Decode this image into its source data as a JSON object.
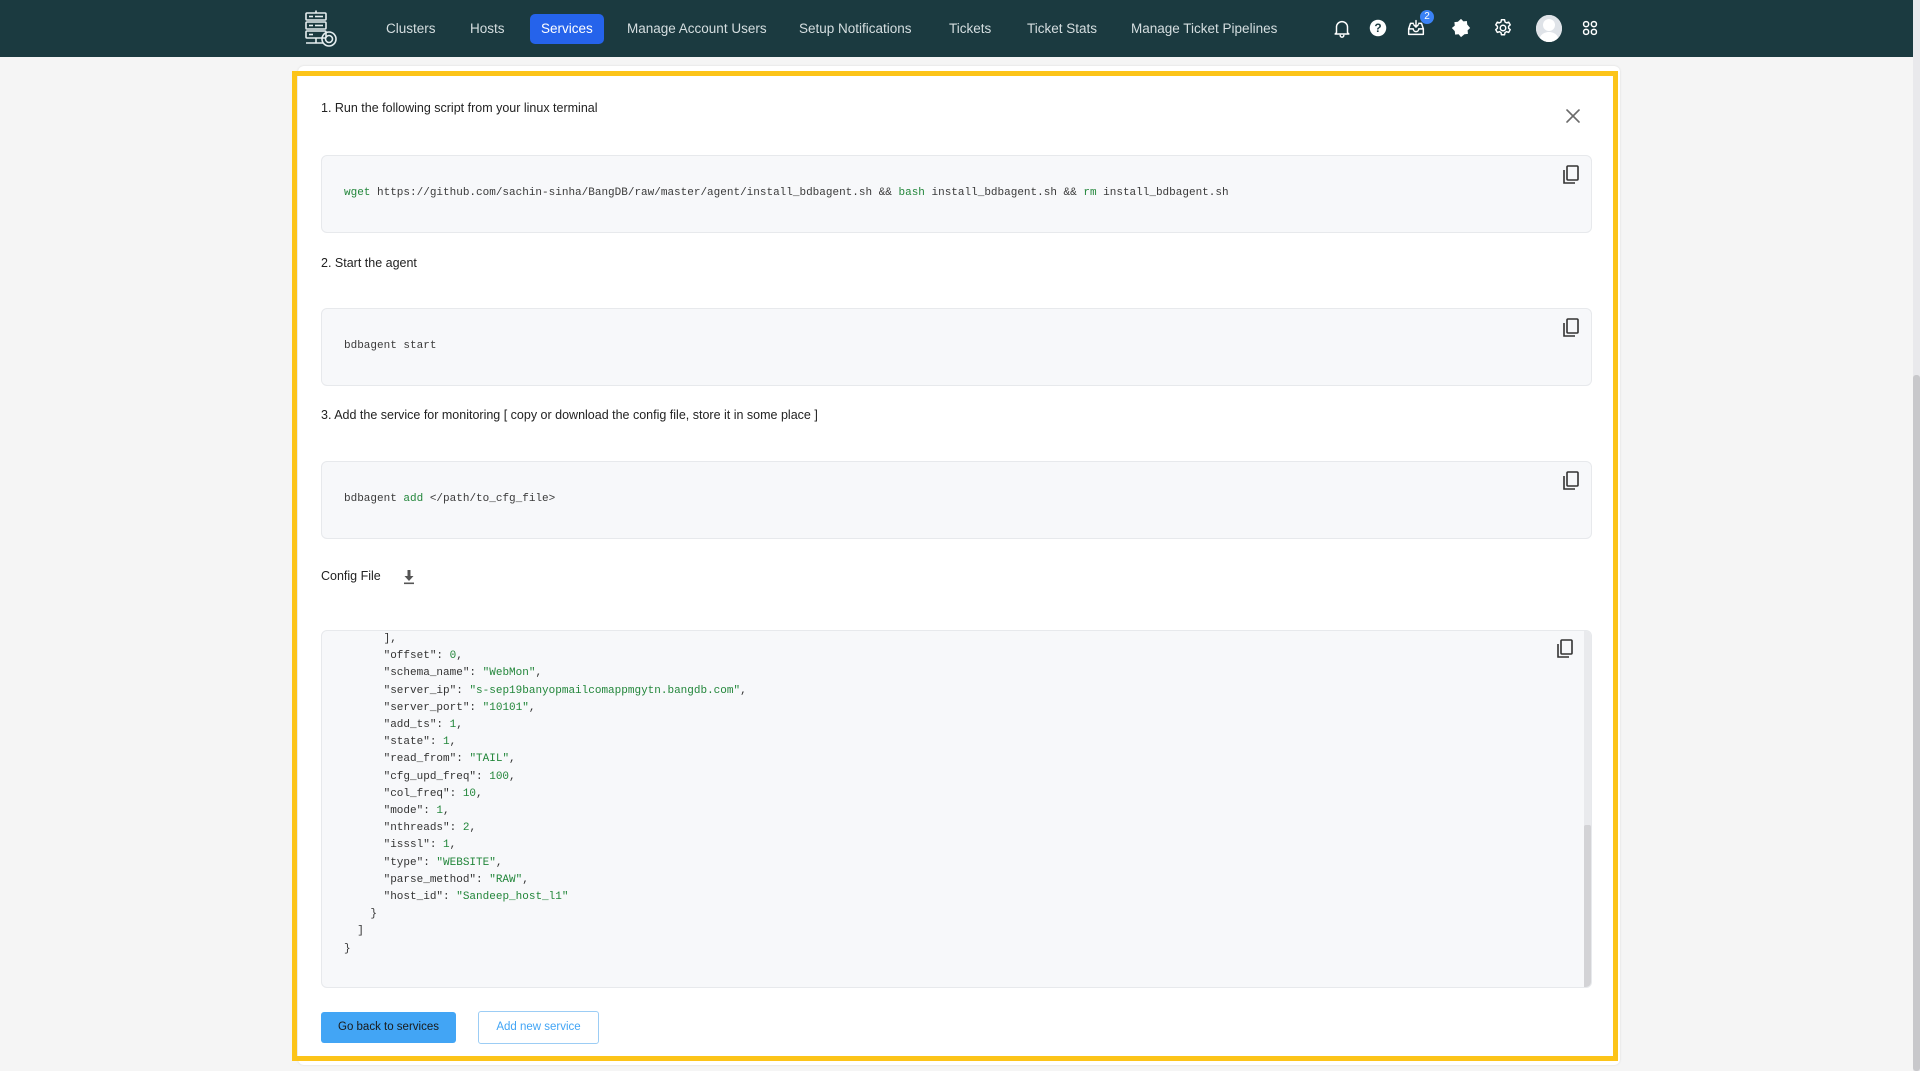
{
  "header": {
    "logo": "server-cluster-logo",
    "nav": [
      {
        "label": "Clusters",
        "active": false
      },
      {
        "label": "Hosts",
        "active": false
      },
      {
        "label": "Services",
        "active": true
      },
      {
        "label": "Manage Account Users",
        "active": false
      },
      {
        "label": "Setup Notifications",
        "active": false
      },
      {
        "label": "Tickets",
        "active": false
      },
      {
        "label": "Ticket Stats",
        "active": false
      },
      {
        "label": "Manage Ticket Pipelines",
        "active": false
      }
    ],
    "icons": [
      "bell-icon",
      "help-icon",
      "inbox-icon",
      "theme-toggle-icon",
      "settings-icon",
      "avatar",
      "apps-grid-icon"
    ],
    "inbox_badge": "2",
    "accent": "#2563eb",
    "bg": "#1b3a40"
  },
  "panel": {
    "step1": "1. Run the following script from your linux terminal",
    "step1_code": {
      "parts": [
        {
          "t": "wget",
          "kw": true
        },
        {
          "t": " https://github.com/sachin-sinha/BangDB/raw/master/agent/install_bdbagent.sh && ",
          "kw": false
        },
        {
          "t": "bash",
          "kw": true
        },
        {
          "t": " install_bdbagent.sh && ",
          "kw": false
        },
        {
          "t": "rm",
          "kw": true
        },
        {
          "t": " install_bdbagent.sh",
          "kw": false
        }
      ]
    },
    "step2": "2. Start the agent",
    "step2_code": {
      "parts": [
        {
          "t": "bdbagent start",
          "kw": false
        }
      ]
    },
    "step3": "3. Add the service for monitoring [ copy or download the config file, store it in some place ]",
    "step3_code": {
      "parts": [
        {
          "t": "bdbagent ",
          "kw": false
        },
        {
          "t": "add",
          "kw": true
        },
        {
          "t": " </path/to_cfg_file>",
          "kw": false
        }
      ]
    },
    "config_label": "Config File",
    "config_lines": [
      {
        "indent": 6,
        "key": null,
        "value": "],",
        "vtype": "punct"
      },
      {
        "indent": 6,
        "key": "offset",
        "value": "0",
        "vtype": "num"
      },
      {
        "indent": 6,
        "key": "schema_name",
        "value": "\"WebMon\"",
        "vtype": "str"
      },
      {
        "indent": 6,
        "key": "server_ip",
        "value": "\"s-sep19banyopmailcomappmgytn.bangdb.com\"",
        "vtype": "str"
      },
      {
        "indent": 6,
        "key": "server_port",
        "value": "\"10101\"",
        "vtype": "str"
      },
      {
        "indent": 6,
        "key": "add_ts",
        "value": "1",
        "vtype": "num"
      },
      {
        "indent": 6,
        "key": "state",
        "value": "1",
        "vtype": "num"
      },
      {
        "indent": 6,
        "key": "read_from",
        "value": "\"TAIL\"",
        "vtype": "str"
      },
      {
        "indent": 6,
        "key": "cfg_upd_freq",
        "value": "100",
        "vtype": "num"
      },
      {
        "indent": 6,
        "key": "col_freq",
        "value": "10",
        "vtype": "num"
      },
      {
        "indent": 6,
        "key": "mode",
        "value": "1",
        "vtype": "num"
      },
      {
        "indent": 6,
        "key": "nthreads",
        "value": "2",
        "vtype": "num"
      },
      {
        "indent": 6,
        "key": "isssl",
        "value": "1",
        "vtype": "num"
      },
      {
        "indent": 6,
        "key": "type",
        "value": "\"WEBSITE\"",
        "vtype": "str"
      },
      {
        "indent": 6,
        "key": "parse_method",
        "value": "\"RAW\"",
        "vtype": "str"
      },
      {
        "indent": 6,
        "key": "host_id",
        "value": "\"Sandeep_host_l1\"",
        "vtype": "str",
        "last": true
      },
      {
        "indent": 4,
        "key": null,
        "value": "}",
        "vtype": "punct"
      },
      {
        "indent": 2,
        "key": null,
        "value": "]",
        "vtype": "punct"
      },
      {
        "indent": 0,
        "key": null,
        "value": "}",
        "vtype": "punct"
      }
    ],
    "buttons": {
      "back": "Go back to services",
      "add": "Add new service"
    },
    "highlight_color": "#fcc419"
  }
}
